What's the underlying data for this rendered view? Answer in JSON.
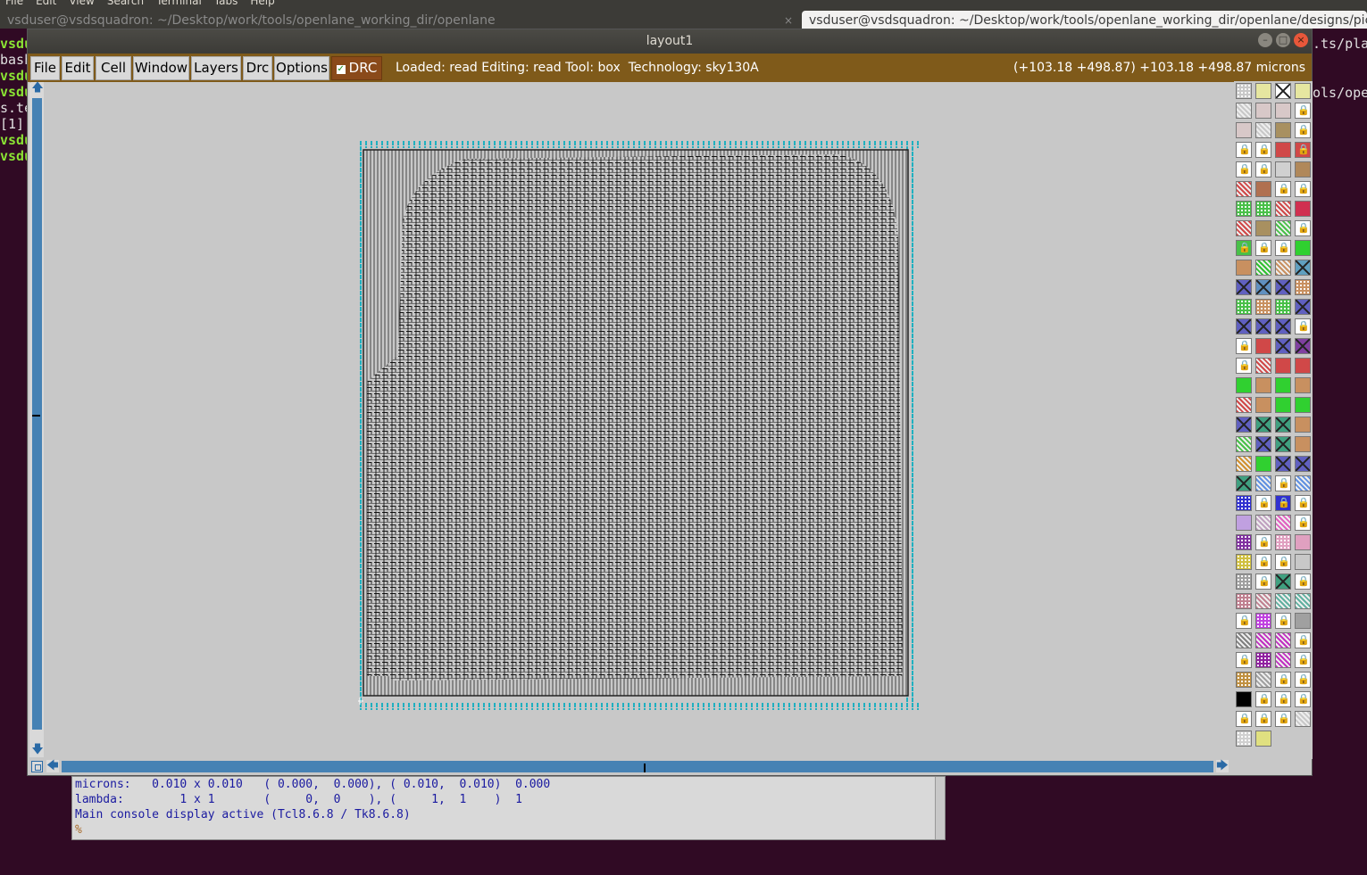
{
  "terminal": {
    "menubar": [
      "File",
      "Edit",
      "View",
      "Search",
      "Terminal",
      "Tabs",
      "Help"
    ],
    "tab1_title": "vsduser@vsdsquadron: ~/Desktop/work/tools/openlane_working_dir/openlane",
    "tab2_title": "vsduser@vsdsquadron: ~/Desktop/work/tools/openlane_working_dir/openlane/designs/pico",
    "tab_close": "×",
    "left_lines": [
      {
        "text": "vsdu",
        "style": "green"
      },
      {
        "text": "bash",
        "style": "white"
      },
      {
        "text": "vsdu",
        "style": "green"
      },
      {
        "text": "vsdu",
        "style": "green"
      },
      {
        "text": "s.te",
        "style": "white"
      },
      {
        "text": "[1]",
        "style": "white"
      },
      {
        "text": "vsdu",
        "style": "green"
      },
      {
        "text": "vsdu",
        "style": "green"
      }
    ],
    "right_lines": [
      ".ts/plac",
      "ols/oper"
    ]
  },
  "window": {
    "title": "layout1",
    "buttons": {
      "minimize": "–",
      "maximize": "□",
      "close": "×"
    }
  },
  "menu": {
    "items": [
      "File",
      "Edit",
      "Cell",
      "Window",
      "Layers",
      "Drc",
      "Options"
    ],
    "drc_toggle": {
      "label": "DRC",
      "checked": true,
      "check_glyph": "✓"
    },
    "status_left": "Loaded: read Editing: read Tool: box  Technology: sky130A",
    "status_right": "(+103.18 +498.87) +103.18 +498.87 microns"
  },
  "scroll": {
    "up": "🡅",
    "down": "🡇",
    "left": "🡄",
    "right": "🡆"
  },
  "palette": {
    "rows": [
      [
        [
          "#c8c8c8",
          "dots"
        ],
        [
          "#e6e6a0",
          "plain"
        ],
        [
          "#ffffff",
          "box"
        ],
        [
          "#e6e6a0",
          "plain"
        ]
      ],
      [
        [
          "#c8c8c8",
          "hatch"
        ],
        [
          "#d8c8c8",
          "plain"
        ],
        [
          "#d8c8c8",
          "plain"
        ],
        [
          "#ffffff",
          "lock"
        ]
      ],
      [
        [
          "#d8c8c8",
          "plain"
        ],
        [
          "#c8c8c8",
          "hatch"
        ],
        [
          "#a89060",
          "plain"
        ],
        [
          "#ffffff",
          "lock"
        ]
      ],
      [
        [
          "#ffffff",
          "lock"
        ],
        [
          "#ffffff",
          "lock"
        ],
        [
          "#d04848",
          "plain"
        ],
        [
          "#d04848",
          "lock"
        ]
      ],
      [
        [
          "#ffffff",
          "lock"
        ],
        [
          "#ffffff",
          "lock"
        ],
        [
          "#d0d0d0",
          "plain"
        ],
        [
          "#b0885a",
          "plain"
        ]
      ],
      [
        [
          "#d04848",
          "hatch"
        ],
        [
          "#b07050",
          "plain"
        ],
        [
          "#ffffff",
          "lock"
        ],
        [
          "#ffffff",
          "lock"
        ]
      ],
      [
        [
          "#48c048",
          "dots"
        ],
        [
          "#48c048",
          "dots"
        ],
        [
          "#d04848",
          "hatch"
        ],
        [
          "#d03050",
          "plain"
        ]
      ],
      [
        [
          "#d04848",
          "hatch"
        ],
        [
          "#a89060",
          "plain"
        ],
        [
          "#48c048",
          "hatch"
        ],
        [
          "#ffffff",
          "lock"
        ]
      ],
      [
        [
          "#48c048",
          "lock"
        ],
        [
          "#ffffff",
          "lock"
        ],
        [
          "#ffffff",
          "lock"
        ],
        [
          "#30d030",
          "plain"
        ]
      ],
      [
        [
          "#c89060",
          "plain"
        ],
        [
          "#30c030",
          "hatch"
        ],
        [
          "#c89060",
          "hatch"
        ],
        [
          "#60a0c0",
          "box"
        ]
      ],
      [
        [
          "#6060c0",
          "box"
        ],
        [
          "#6090c0",
          "box"
        ],
        [
          "#6060c0",
          "box"
        ],
        [
          "#c89060",
          "dots"
        ]
      ],
      [
        [
          "#48c048",
          "dots"
        ],
        [
          "#c89060",
          "dots"
        ],
        [
          "#48c048",
          "dots"
        ],
        [
          "#6060c0",
          "box"
        ]
      ],
      [
        [
          "#6060c0",
          "box"
        ],
        [
          "#6060c0",
          "box"
        ],
        [
          "#6060c0",
          "box"
        ],
        [
          "#ffffff",
          "lock"
        ]
      ],
      [
        [
          "#ffffff",
          "lock"
        ],
        [
          "#d04848",
          "plain"
        ],
        [
          "#6060c0",
          "box"
        ],
        [
          "#8040a0",
          "box"
        ]
      ],
      [
        [
          "#ffffff",
          "lock"
        ],
        [
          "#d04848",
          "hatch"
        ],
        [
          "#d04848",
          "plain"
        ],
        [
          "#d04848",
          "plain"
        ]
      ],
      [
        [
          "#30d030",
          "plain"
        ],
        [
          "#c89060",
          "plain"
        ],
        [
          "#30d030",
          "plain"
        ],
        [
          "#c89060",
          "plain"
        ]
      ],
      [
        [
          "#d04848",
          "hatch"
        ],
        [
          "#c89060",
          "plain"
        ],
        [
          "#30d030",
          "plain"
        ],
        [
          "#30d030",
          "plain"
        ]
      ],
      [
        [
          "#6060c0",
          "box"
        ],
        [
          "#40a080",
          "box"
        ],
        [
          "#40a080",
          "box"
        ],
        [
          "#c89060",
          "plain"
        ]
      ],
      [
        [
          "#48c048",
          "hatch"
        ],
        [
          "#6060c0",
          "box"
        ],
        [
          "#40a080",
          "box"
        ],
        [
          "#c89060",
          "plain"
        ]
      ],
      [
        [
          "#d09030",
          "hatch"
        ],
        [
          "#30d030",
          "plain"
        ],
        [
          "#6060c0",
          "box"
        ],
        [
          "#6060c0",
          "box"
        ]
      ],
      [
        [
          "#40a080",
          "box"
        ],
        [
          "#6090e0",
          "hatch"
        ],
        [
          "#ffffff",
          "lock"
        ],
        [
          "#6090e0",
          "hatch"
        ]
      ],
      [
        [
          "#3030d0",
          "dots"
        ],
        [
          "#ffffff",
          "lock"
        ],
        [
          "#3030d0",
          "lock"
        ],
        [
          "#ffffff",
          "lock"
        ]
      ],
      [
        [
          "#c0a0e0",
          "plain"
        ],
        [
          "#c0a0c0",
          "hatch"
        ],
        [
          "#e060c0",
          "hatch"
        ],
        [
          "#ffffff",
          "lock"
        ]
      ],
      [
        [
          "#8030a0",
          "dots"
        ],
        [
          "#ffffff",
          "lock"
        ],
        [
          "#e0a0c0",
          "dots"
        ],
        [
          "#e0a0c0",
          "plain"
        ]
      ],
      [
        [
          "#d0c040",
          "dots"
        ],
        [
          "#ffffff",
          "lock"
        ],
        [
          "#ffffff",
          "lock"
        ],
        [
          "#c8c8c8",
          "plain"
        ]
      ],
      [
        [
          "#a0a0a0",
          "dots"
        ],
        [
          "#ffffff",
          "lock"
        ],
        [
          "#40a080",
          "box"
        ],
        [
          "#ffffff",
          "lock"
        ]
      ],
      [
        [
          "#c08090",
          "dots"
        ],
        [
          "#c08090",
          "hatch"
        ],
        [
          "#60b0a0",
          "hatch"
        ],
        [
          "#60b0a0",
          "hatch"
        ]
      ],
      [
        [
          "#ffffff",
          "lock"
        ],
        [
          "#c040e0",
          "dots"
        ],
        [
          "#ffffff",
          "lock"
        ],
        [
          "#a0a0a0",
          "plain"
        ]
      ],
      [
        [
          "#808080",
          "hatch"
        ],
        [
          "#c030c0",
          "hatch"
        ],
        [
          "#c030c0",
          "hatch"
        ],
        [
          "#ffffff",
          "lock"
        ]
      ],
      [
        [
          "#ffffff",
          "lock"
        ],
        [
          "#9020a0",
          "dots"
        ],
        [
          "#c030c0",
          "hatch"
        ],
        [
          "#ffffff",
          "lock"
        ]
      ],
      [
        [
          "#c09040",
          "dots"
        ],
        [
          "#a0a0a0",
          "hatch"
        ],
        [
          "#ffffff",
          "lock"
        ],
        [
          "#ffffff",
          "lock"
        ]
      ],
      [
        [
          "#000000",
          "plain"
        ],
        [
          "#ffffff",
          "lock"
        ],
        [
          "#ffffff",
          "lock"
        ],
        [
          "#ffffff",
          "lock"
        ]
      ],
      [
        [
          "#ffffff",
          "lock"
        ],
        [
          "#ffffff",
          "lock"
        ],
        [
          "#ffffff",
          "lock"
        ],
        [
          "#c8c8c8",
          "hatch"
        ]
      ],
      [
        [
          "#d0d0d0",
          "dots"
        ],
        [
          "#e0e080",
          "plain"
        ]
      ]
    ]
  },
  "console": {
    "lines": [
      "microns:   0.010 x 0.010   ( 0.000,  0.000), ( 0.010,  0.010)  0.000",
      "lambda:        1 x 1       (     0,  0    ), (     1,  1    )  1",
      "Main console display active (Tcl8.6.8 / Tk8.6.8)"
    ],
    "prompt": "%"
  }
}
